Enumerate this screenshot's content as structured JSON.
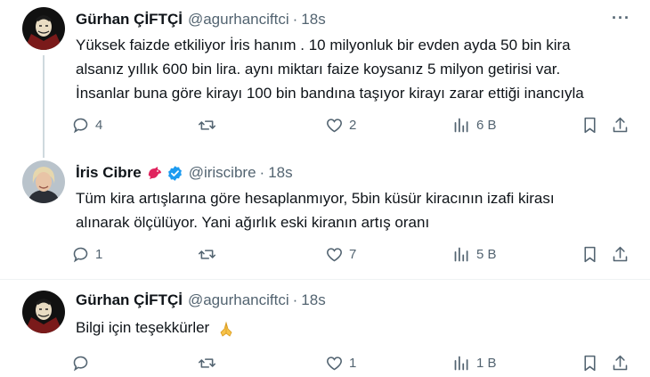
{
  "tweets": [
    {
      "name": "Gürhan ÇİFTÇİ",
      "handle": "@agurhanciftci",
      "time": "18s",
      "text_lines": [
        "Yüksek faizde etkiliyor İris hanım . 10 milyonluk bir evden ayda 50 bin kira",
        "alsanız yıllık 600 bin lira. aynı miktarı faize koysanız 5 milyon getirisi var.",
        "İnsanlar buna göre kirayı 100 bin bandına taşıyor kirayı zarar ettiği inancıyla"
      ],
      "replies": "4",
      "retweets": "",
      "likes": "2",
      "views": "6 B"
    },
    {
      "name": "İris Cibre",
      "handle": "@iriscibre",
      "time": "18s",
      "text_lines": [
        "Tüm kira artışlarına göre hesaplanmıyor, 5bin küsür kiracının izafi kirası",
        "alınarak ölçülüyor. Yani ağırlık eski kiranın artış oranı"
      ],
      "replies": "1",
      "retweets": "",
      "likes": "7",
      "views": "5 B"
    },
    {
      "name": "Gürhan ÇİFTÇİ",
      "handle": "@agurhanciftci",
      "time": "18s",
      "text_lines": [
        "Bilgi için teşekkürler"
      ],
      "replies": "",
      "retweets": "",
      "likes": "1",
      "views": "1 B"
    }
  ],
  "colors": {
    "text": "#0f1419",
    "muted": "#536471",
    "verified": "#1d9bf0",
    "bird": "#e0245e"
  },
  "icons": [
    "reply-icon",
    "retweet-icon",
    "like-icon",
    "views-icon",
    "bookmark-icon",
    "share-icon",
    "more-icon",
    "verified-badge-icon",
    "red-bird-icon",
    "folded-hands-icon"
  ]
}
